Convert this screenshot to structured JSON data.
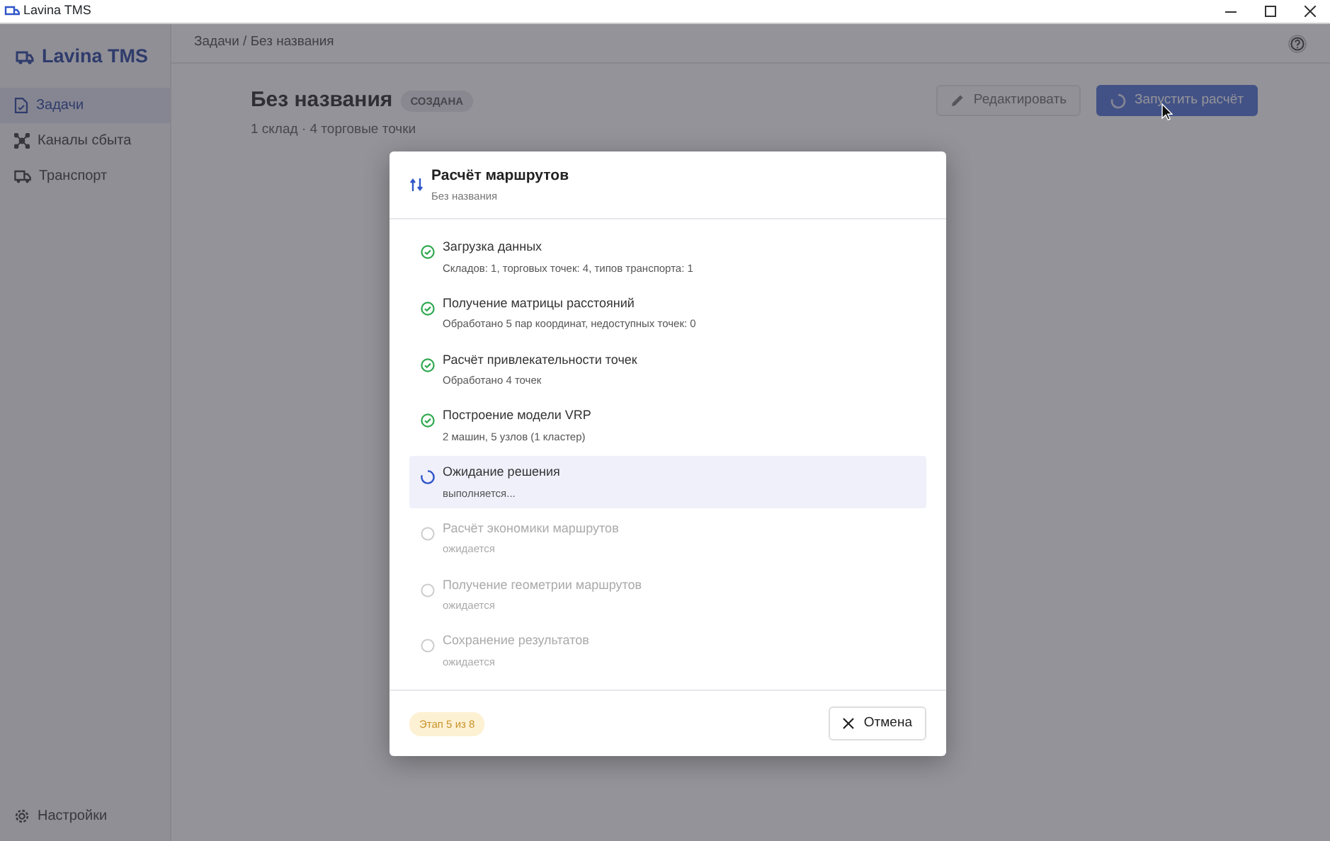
{
  "window": {
    "title": "Lavina TMS"
  },
  "sidebar": {
    "logo": "Lavina TMS",
    "items": [
      {
        "label": "Задачи",
        "selected": true
      },
      {
        "label": "Каналы сбыта",
        "selected": false
      },
      {
        "label": "Транспорт",
        "selected": false
      }
    ],
    "footer_item": {
      "label": "Настройки"
    }
  },
  "breadcrumb": "Задачи / Без названия",
  "task": {
    "title": "Без названия",
    "status_badge": "СОЗДАНА",
    "subtitle": "1 склад · 4 торговые точки"
  },
  "actions": [
    {
      "label": "Редактировать",
      "kind": "edit",
      "disabled": true
    },
    {
      "label": "Запустить расчёт",
      "kind": "run",
      "disabled": false
    }
  ],
  "dialog": {
    "title": "Расчёт маршрутов",
    "subtitle": "Без названия",
    "steps": [
      {
        "title": "Загрузка данных",
        "detail": "Складов: 1, торговых точек: 4, типов транспорта: 1",
        "kind": "done"
      },
      {
        "title": "Получение матрицы расстояний",
        "detail": "Обработано 5 пар координат, недоступных точек: 0",
        "kind": "done"
      },
      {
        "title": "Расчёт привлекательности точек",
        "detail": "Обработано 4 точек",
        "kind": "done"
      },
      {
        "title": "Построение модели VRP",
        "detail": "2 машин, 5 узлов (1 кластер)",
        "kind": "done"
      },
      {
        "title": "Ожидание решения",
        "detail": "выполняется...",
        "kind": "running"
      },
      {
        "title": "Расчёт экономики маршрутов",
        "detail": "ожидается",
        "kind": "pending"
      },
      {
        "title": "Получение геометрии маршрутов",
        "detail": "ожидается",
        "kind": "pending"
      },
      {
        "title": "Сохранение результатов",
        "detail": "ожидается",
        "kind": "pending"
      }
    ],
    "stage_badge": "Этап 5 из 8",
    "cancel": "Отмена"
  }
}
